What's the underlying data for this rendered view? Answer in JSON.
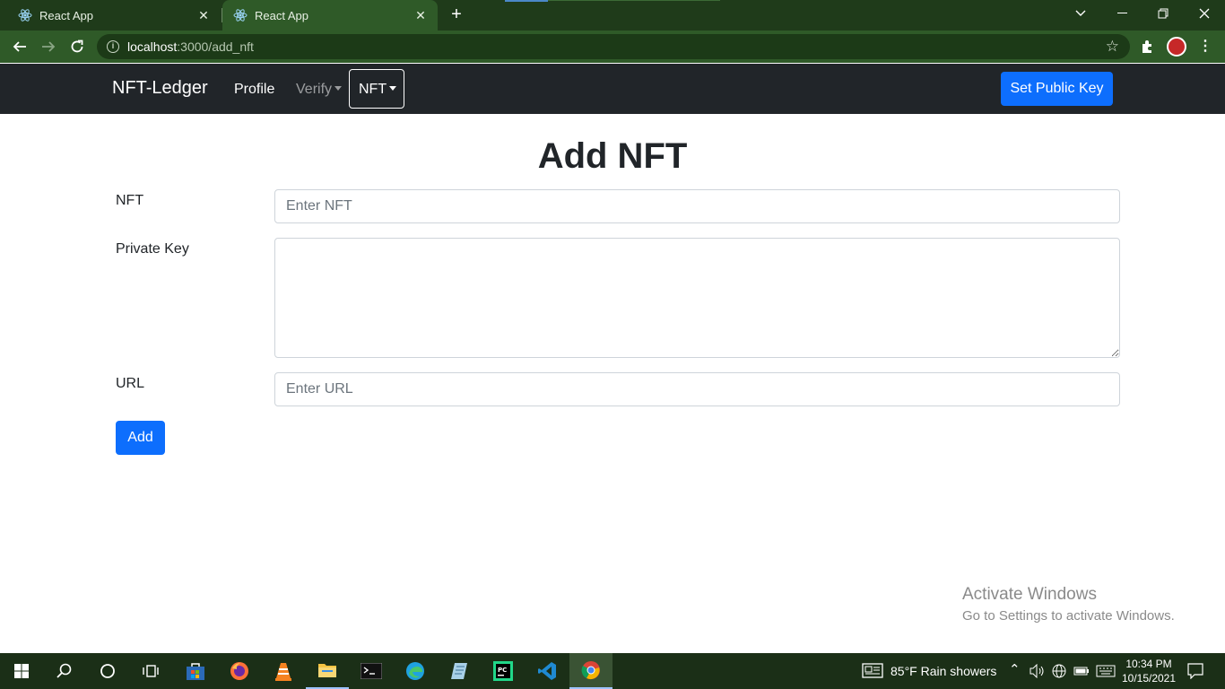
{
  "browser": {
    "tabs": [
      {
        "title": "React App",
        "active": false
      },
      {
        "title": "React App",
        "active": true
      }
    ],
    "url_host": "localhost",
    "url_path": ":3000/add_nft"
  },
  "navbar": {
    "brand": "NFT-Ledger",
    "links": [
      {
        "label": "Profile"
      },
      {
        "label": "Verify",
        "dropdown": true
      },
      {
        "label": "NFT",
        "dropdown": true,
        "active": true
      }
    ],
    "set_key_label": "Set Public Key"
  },
  "form": {
    "title": "Add NFT",
    "nft_label": "NFT",
    "nft_placeholder": "Enter NFT",
    "nft_value": "",
    "private_key_label": "Private Key",
    "private_key_value": "",
    "url_label": "URL",
    "url_placeholder": "Enter URL",
    "url_value": "",
    "submit_label": "Add"
  },
  "watermark": {
    "line1": "Activate Windows",
    "line2": "Go to Settings to activate Windows."
  },
  "taskbar": {
    "apps": [
      "start-icon",
      "search-icon",
      "cortana-icon",
      "task-view-icon",
      "store-icon",
      "firefox-icon",
      "vlc-icon",
      "file-explorer-icon",
      "terminal-icon",
      "edge-icon",
      "notepad-icon",
      "pycharm-icon",
      "vscode-icon",
      "chrome-icon"
    ],
    "weather": "85°F  Rain showers",
    "time": "10:34 PM",
    "date": "10/15/2021"
  },
  "colors": {
    "primary": "#0d6efd",
    "navbar_bg": "#212529",
    "browser_frame": "#2f5a28"
  }
}
